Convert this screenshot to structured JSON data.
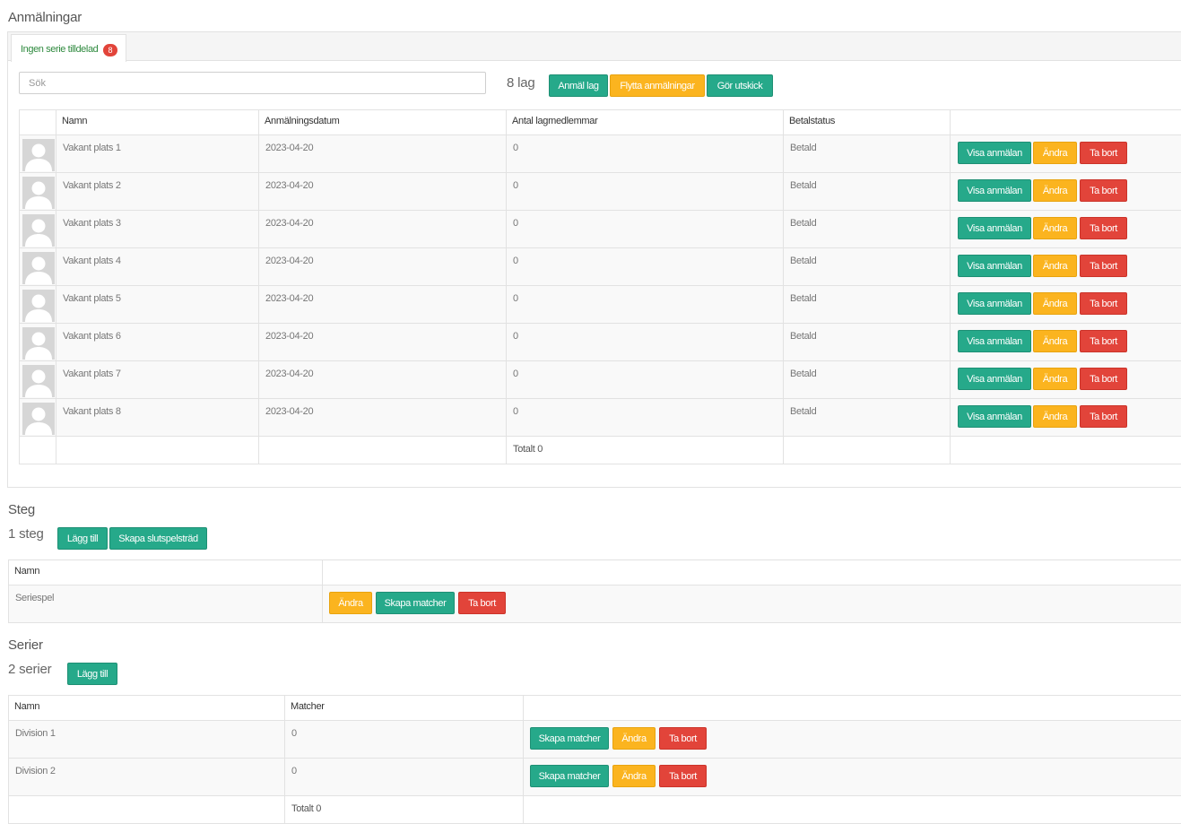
{
  "registrations": {
    "title": "Anmälningar",
    "tab": {
      "label": "Ingen serie tilldelad",
      "badge": "8"
    },
    "search": {
      "placeholder": "Sök",
      "value": ""
    },
    "count": "8 lag",
    "actions": {
      "register": "Anmäl lag",
      "move": "Flytta anmälningar",
      "mailout": "Gör utskick"
    },
    "columns": [
      "",
      "Namn",
      "Anmälningsdatum",
      "Antal lagmedlemmar",
      "Betalstatus",
      ""
    ],
    "rows": [
      {
        "name": "Vakant plats 1",
        "date": "2023-04-20",
        "members": "0",
        "status": "Betald"
      },
      {
        "name": "Vakant plats 2",
        "date": "2023-04-20",
        "members": "0",
        "status": "Betald"
      },
      {
        "name": "Vakant plats 3",
        "date": "2023-04-20",
        "members": "0",
        "status": "Betald"
      },
      {
        "name": "Vakant plats 4",
        "date": "2023-04-20",
        "members": "0",
        "status": "Betald"
      },
      {
        "name": "Vakant plats 5",
        "date": "2023-04-20",
        "members": "0",
        "status": "Betald"
      },
      {
        "name": "Vakant plats 6",
        "date": "2023-04-20",
        "members": "0",
        "status": "Betald"
      },
      {
        "name": "Vakant plats 7",
        "date": "2023-04-20",
        "members": "0",
        "status": "Betald"
      },
      {
        "name": "Vakant plats 8",
        "date": "2023-04-20",
        "members": "0",
        "status": "Betald"
      }
    ],
    "row_actions": {
      "view": "Visa anmälan",
      "edit": "Ändra",
      "delete": "Ta bort"
    },
    "total": "Totalt 0"
  },
  "steps": {
    "title": "Steg",
    "count": "1 steg",
    "actions": {
      "add": "Lägg till",
      "bracket": "Skapa slutspelsträd"
    },
    "columns": [
      "Namn",
      ""
    ],
    "rows": [
      {
        "name": "Seriespel"
      }
    ],
    "row_actions": {
      "edit": "Ändra",
      "create_matches": "Skapa matcher",
      "delete": "Ta bort"
    }
  },
  "series": {
    "title": "Serier",
    "count": "2 serier",
    "actions": {
      "add": "Lägg till"
    },
    "columns": [
      "Namn",
      "Matcher",
      ""
    ],
    "rows": [
      {
        "name": "Division 1",
        "matches": "0"
      },
      {
        "name": "Division 2",
        "matches": "0"
      }
    ],
    "row_actions": {
      "create_matches": "Skapa matcher",
      "edit": "Ändra",
      "delete": "Ta bort"
    },
    "total": "Totalt 0"
  },
  "colors": {
    "green": "#26a98a",
    "yellow": "#fbb41f",
    "red": "#e2443a",
    "tab_text": "#2f8a3f"
  },
  "icons": {
    "avatar": "user-placeholder-icon"
  }
}
